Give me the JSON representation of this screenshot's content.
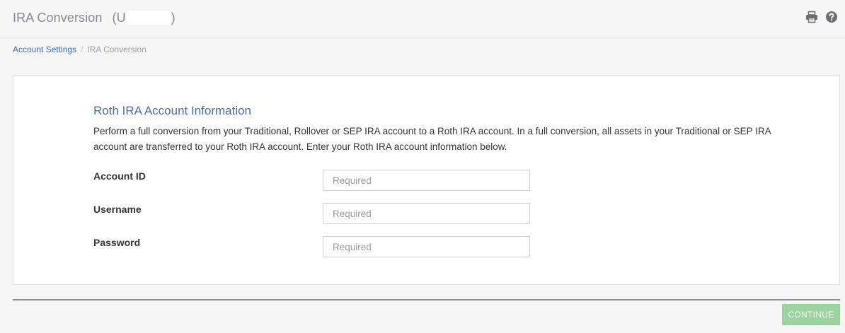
{
  "header": {
    "title": "IRA Conversion",
    "account_open": "(U",
    "account_close": ")",
    "icons": [
      "print-icon",
      "help-icon"
    ]
  },
  "breadcrumb": {
    "parent": "Account Settings",
    "separator": "/",
    "current": "IRA Conversion"
  },
  "form": {
    "section_title": "Roth IRA Account Information",
    "description": "Perform a full conversion from your Traditional, Rollover or SEP IRA account to a Roth IRA account. In a full conversion, all assets in your Traditional or SEP IRA account are transferred to your Roth IRA account. Enter your Roth IRA account information below.",
    "fields": [
      {
        "label": "Account ID",
        "value": "",
        "placeholder": "Required"
      },
      {
        "label": "Username",
        "value": "",
        "placeholder": "Required"
      },
      {
        "label": "Password",
        "value": "",
        "placeholder": "Required"
      }
    ]
  },
  "footer": {
    "continue_label": "CONTINUE"
  },
  "colors": {
    "accent_title": "#4b6f96",
    "link": "#3c6aa3",
    "continue_button": "#9bd39e"
  }
}
